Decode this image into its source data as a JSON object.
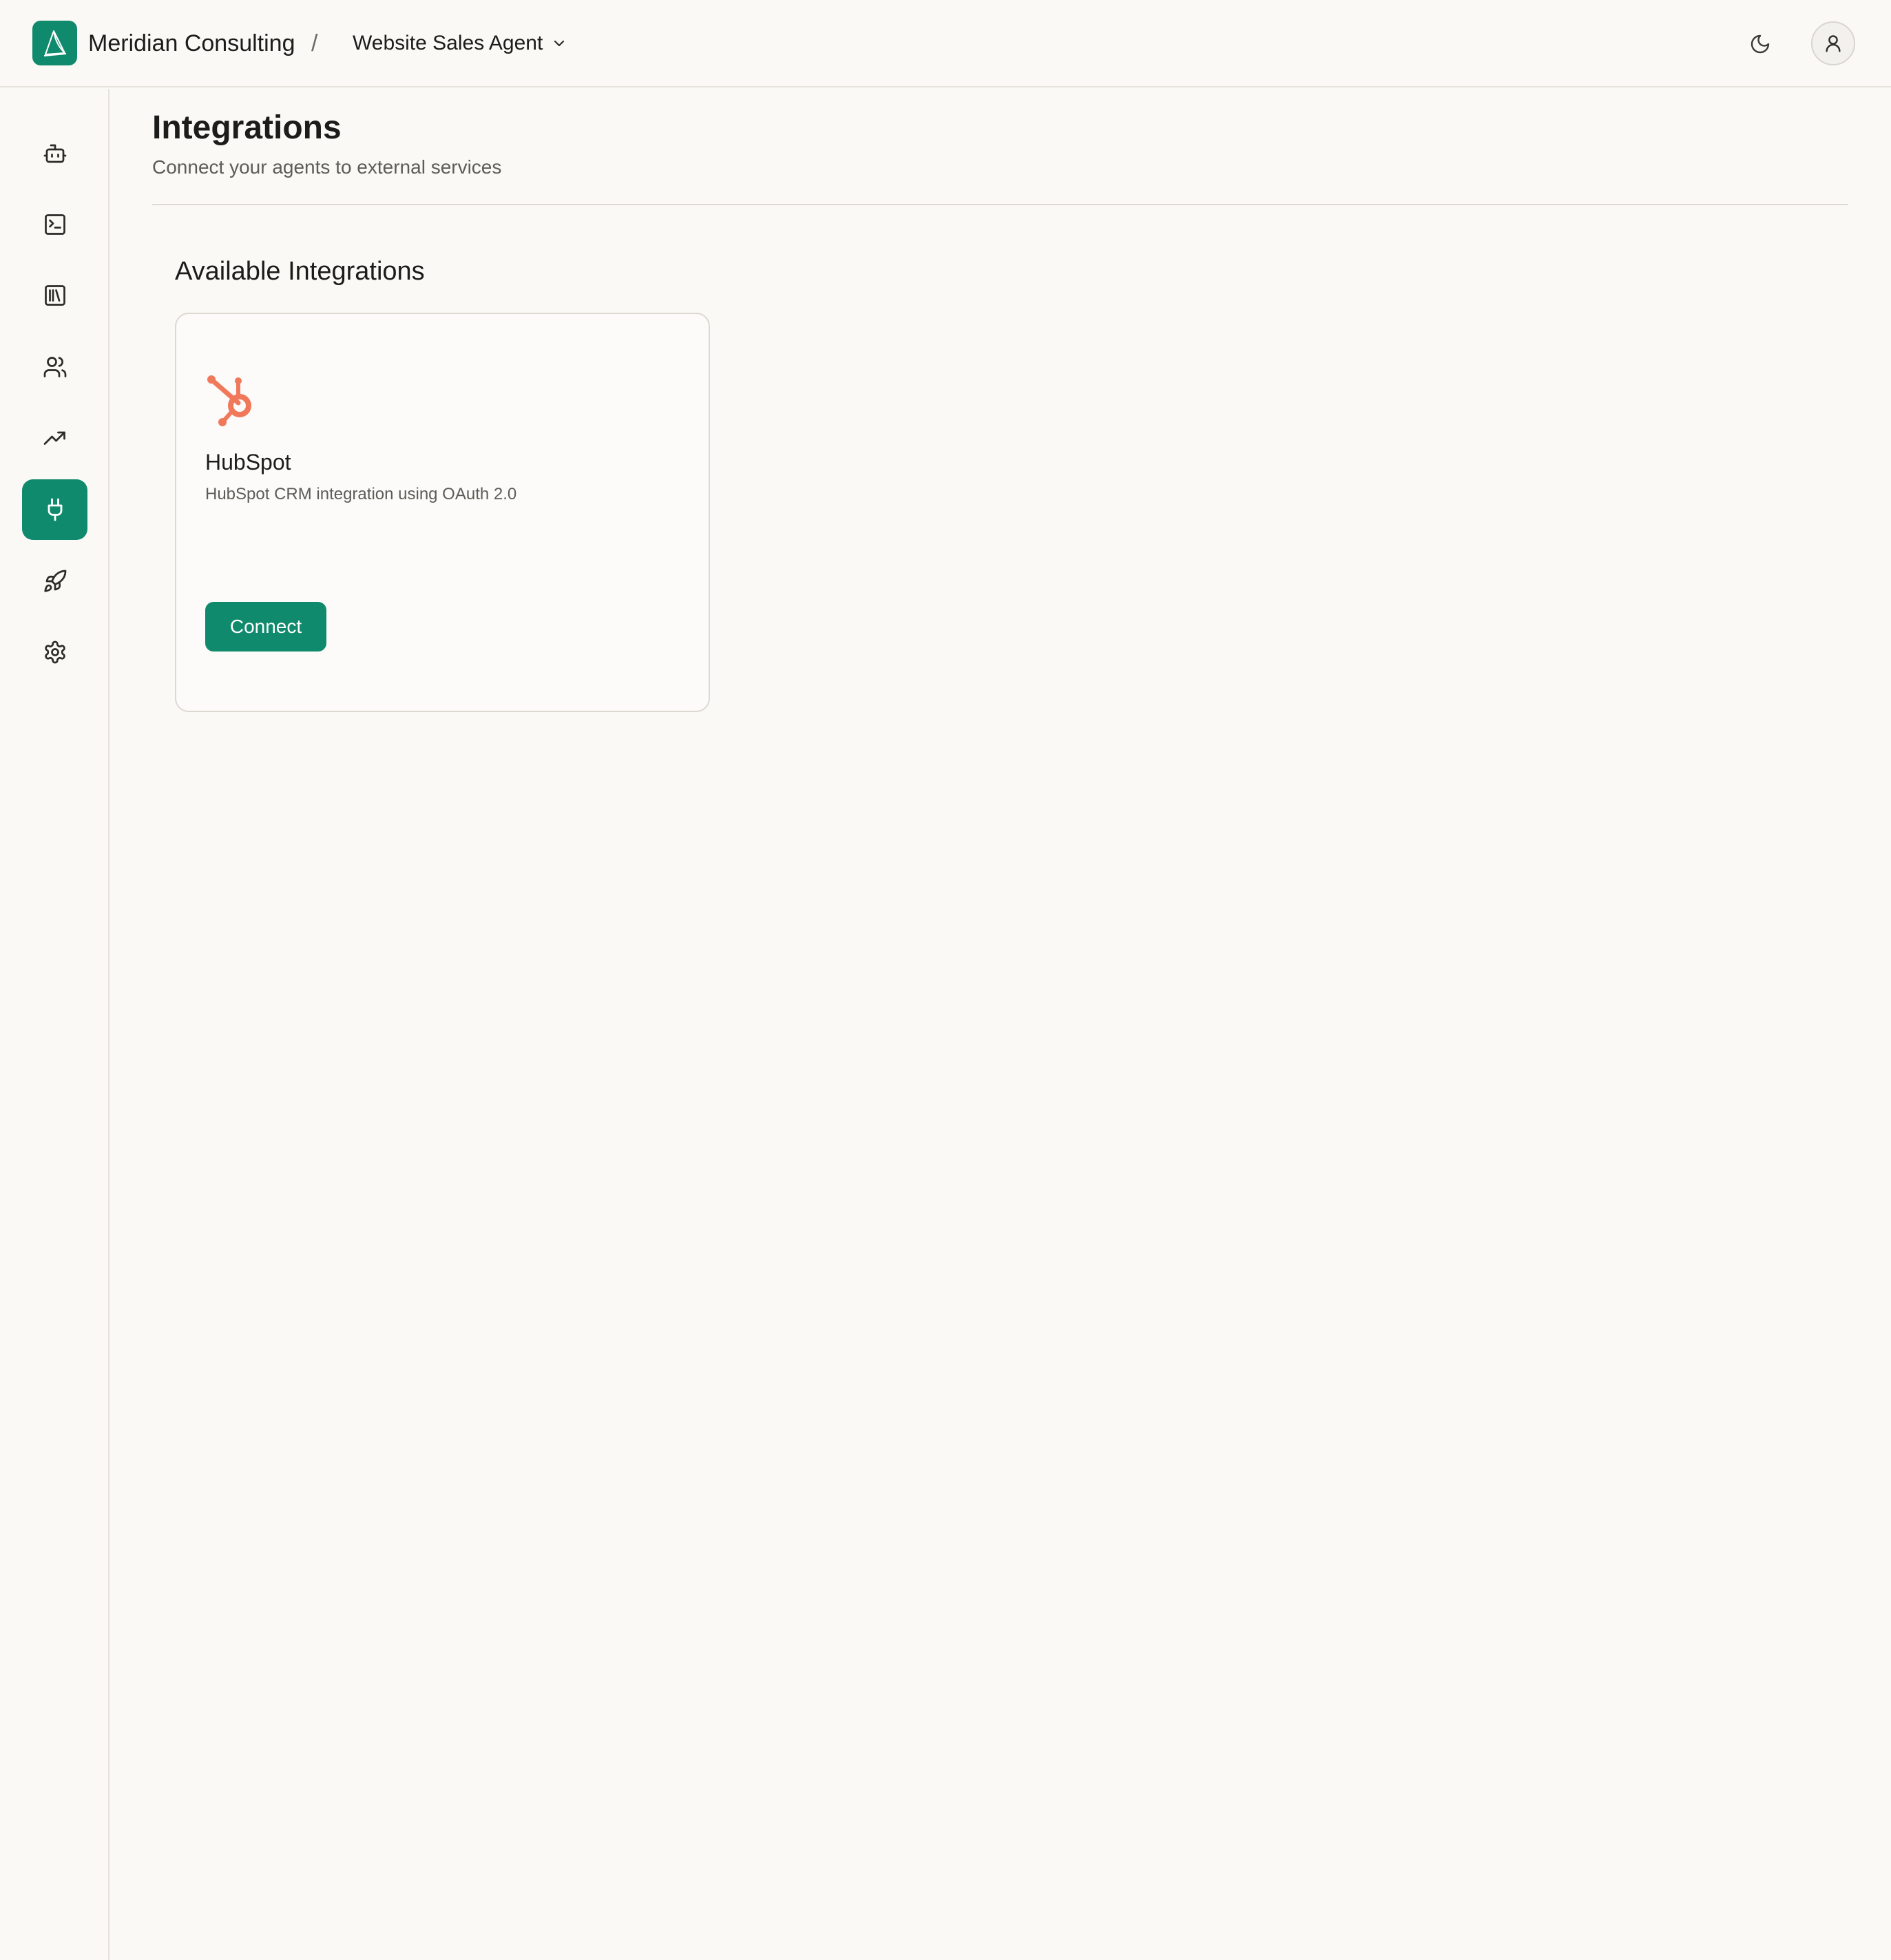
{
  "header": {
    "org_name": "Meridian Consulting",
    "separator": "/",
    "agent_name": "Website Sales Agent",
    "icons": [
      "logo-sail-icon",
      "chevron-down-icon",
      "moon-icon",
      "user-icon"
    ]
  },
  "sidebar": {
    "items": [
      {
        "id": "agents",
        "icon": "bot-icon",
        "active": false
      },
      {
        "id": "console",
        "icon": "terminal-icon",
        "active": false
      },
      {
        "id": "library",
        "icon": "library-icon",
        "active": false
      },
      {
        "id": "users",
        "icon": "users-icon",
        "active": false
      },
      {
        "id": "analytics",
        "icon": "trending-up-icon",
        "active": false
      },
      {
        "id": "integrations",
        "icon": "plug-icon",
        "active": true
      },
      {
        "id": "deploy",
        "icon": "rocket-icon",
        "active": false
      },
      {
        "id": "settings",
        "icon": "gear-icon",
        "active": false
      }
    ]
  },
  "main": {
    "title": "Integrations",
    "subtitle": "Connect your agents to external services",
    "section_title": "Available Integrations",
    "integrations": [
      {
        "name": "HubSpot",
        "description": "HubSpot CRM integration using OAuth 2.0",
        "icon": "hubspot-icon",
        "button_label": "Connect"
      }
    ]
  },
  "colors": {
    "accent": "#0f8a6c",
    "background": "#fbf9f5",
    "hubspot": "#f0795b"
  }
}
